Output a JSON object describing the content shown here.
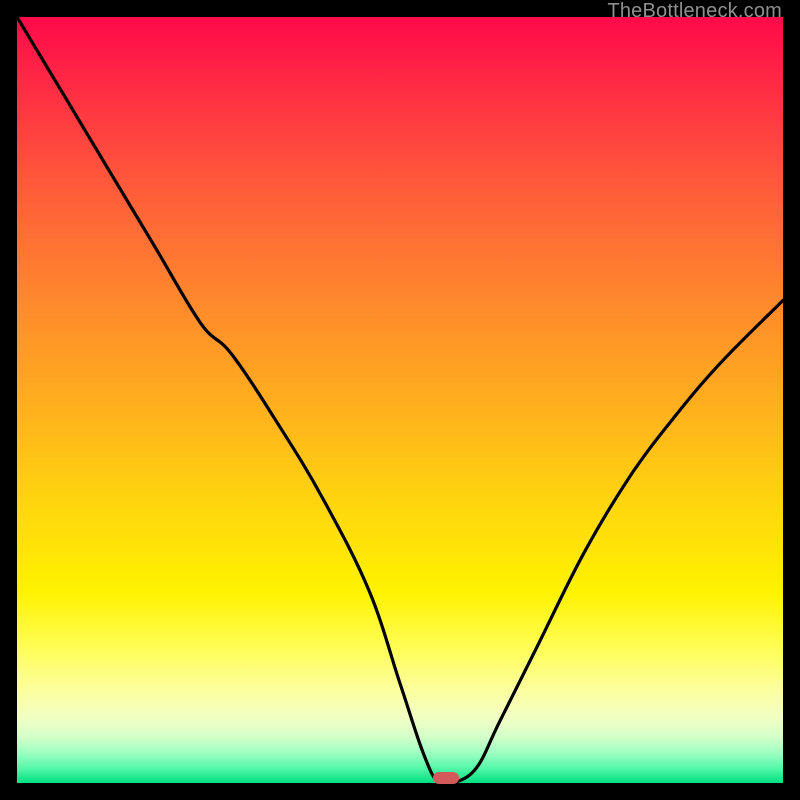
{
  "watermark": "TheBottleneck.com",
  "colors": {
    "frame": "#000000",
    "curve": "#000000",
    "marker": "#d25a5a"
  },
  "chart_data": {
    "type": "line",
    "title": "",
    "xlabel": "",
    "ylabel": "",
    "xlim": [
      0,
      100
    ],
    "ylim": [
      0,
      100
    ],
    "grid": false,
    "legend": false,
    "series": [
      {
        "name": "bottleneck-percentage",
        "x": [
          0,
          6,
          12,
          18,
          24,
          28,
          34,
          40,
          46,
          50,
          53,
          55,
          57,
          60,
          63,
          68,
          74,
          80,
          86,
          92,
          100
        ],
        "y": [
          100,
          90,
          80,
          70,
          60,
          56,
          47,
          37,
          25,
          13,
          4,
          0,
          0,
          2,
          8,
          18,
          30,
          40,
          48,
          55,
          63
        ]
      }
    ],
    "annotations": [
      {
        "name": "optimal-marker",
        "x": 56,
        "y": 0.7
      }
    ],
    "background_gradient": {
      "direction": "vertical",
      "stops": [
        {
          "pos": 0,
          "color": "#ff0a4a"
        },
        {
          "pos": 0.5,
          "color": "#ffad1e"
        },
        {
          "pos": 0.75,
          "color": "#fff200"
        },
        {
          "pos": 0.94,
          "color": "#d3ffc9"
        },
        {
          "pos": 1.0,
          "color": "#00e080"
        }
      ]
    }
  }
}
